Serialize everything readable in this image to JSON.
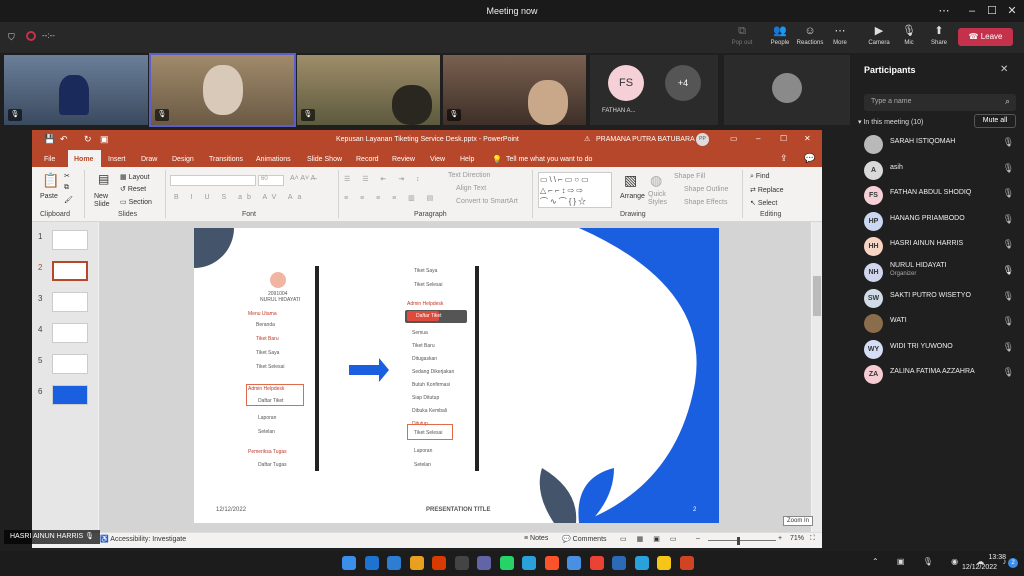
{
  "window": {
    "title": "Meeting now"
  },
  "teams_toolbar": {
    "timer": "--:--",
    "pop_out": "Pop out",
    "people": "People",
    "reactions": "Reactions",
    "more": "More",
    "camera": "Camera",
    "mic": "Mic",
    "share": "Share",
    "leave": "Leave"
  },
  "videos": {
    "fs_initials": "FS",
    "fs_name": "FATHAN A...",
    "overflow": "+4",
    "bottom_name": "HASRI AINUN HARRIS"
  },
  "participants": {
    "title": "Participants",
    "search_placeholder": "Type a name",
    "in_meeting": "In this meeting (10)",
    "mute_all": "Mute all",
    "list": [
      {
        "initials": "",
        "name": "SARAH ISTIQOMAH",
        "role": "",
        "color": "#b9b9b9"
      },
      {
        "initials": "A",
        "name": "asih",
        "role": "",
        "color": "#d9d9d9"
      },
      {
        "initials": "FS",
        "name": "FATHAN ABDUL SHODIQ",
        "role": "",
        "color": "#f6d0d7"
      },
      {
        "initials": "HP",
        "name": "HANANG PRIAMBODO",
        "role": "",
        "color": "#c9d7f3"
      },
      {
        "initials": "HH",
        "name": "HASRI AINUN HARRIS",
        "role": "",
        "color": "#f7d5c4"
      },
      {
        "initials": "NH",
        "name": "NURUL HIDAYATI",
        "role": "Organizer",
        "color": "#cfd6ee"
      },
      {
        "initials": "SW",
        "name": "SAKTI PUTRO WISETYO",
        "role": "",
        "color": "#d2dce6"
      },
      {
        "initials": "",
        "name": "WATI",
        "role": "",
        "color": "#8a6d4a"
      },
      {
        "initials": "WY",
        "name": "WIDI TRI YUWONO",
        "role": "",
        "color": "#d6def5"
      },
      {
        "initials": "ZA",
        "name": "ZALINA FATIMA AZZAHRA",
        "role": "",
        "color": "#f6ccd3"
      }
    ]
  },
  "ppt": {
    "title": "Kepusan Layanan Tiketing Service Desk.pptx  -  PowerPoint",
    "user": "PRAMANA PUTRA BATUBARA",
    "user_initials": "PP",
    "tabs": [
      "File",
      "Home",
      "Insert",
      "Draw",
      "Design",
      "Transitions",
      "Animations",
      "Slide Show",
      "Record",
      "Review",
      "View",
      "Help"
    ],
    "tell_me": "Tell me what you want to do",
    "groups": {
      "clipboard": "Clipboard",
      "slides": "Slides",
      "font": "Font",
      "paragraph": "Paragraph",
      "drawing": "Drawing",
      "editing": "Editing"
    },
    "buttons": {
      "paste": "Paste",
      "new_slide": "New Slide",
      "layout": "Layout",
      "reset": "Reset",
      "section": "Section",
      "text_direction": "Text Direction",
      "align_text": "Align Text",
      "convert_smartart": "Convert to SmartArt",
      "arrange": "Arrange",
      "quick_styles": "Quick Styles",
      "shape_fill": "Shape Fill",
      "shape_outline": "Shape Outline",
      "shape_effects": "Shape Effects",
      "find": "Find",
      "replace": "Replace",
      "select": "Select",
      "font_size": "60"
    },
    "slide_numbers": [
      "1",
      "2",
      "3",
      "4",
      "5",
      "6"
    ],
    "slide": {
      "date": "12/12/2022",
      "footer": "PRESENTATION TITLE",
      "page": "2",
      "left": {
        "id": "2091004",
        "user": "NURUL HIDAYATI",
        "menu_header": "Menu Utama",
        "items": [
          "Beranda",
          "Tiket Baru",
          "Tiket Saya",
          "Tiket Selesai"
        ],
        "admin_header": "Admin Helpdesk",
        "admin_item": "Daftar Tiket",
        "laporan": "Laporan",
        "setelan": "Setelan",
        "pemeriksa_header": "Pemeriksa Tugas",
        "daftar_tugas": "Daftar Tugas"
      },
      "right": {
        "items_top": [
          "Tiket Saya",
          "Tiket Selesai"
        ],
        "admin_header": "Admin Helpdesk",
        "daftar": "Daftar Tiket",
        "sub": [
          "Semua",
          "Tiket Baru",
          "Ditugaskan",
          "Sedang Dikerjakan",
          "Butuh Konfirmasi",
          "Siap Ditutup",
          "Dibuka Kembali"
        ],
        "ditutup": "Ditutup",
        "selesai": "Tiket Selesai",
        "laporan": "Laporan",
        "setelan": "Setelan"
      }
    },
    "status": {
      "accessibility": "Accessibility: Investigate",
      "notes": "Notes",
      "comments": "Comments",
      "zoom": "71%",
      "zoom_tooltip": "Zoom In"
    }
  },
  "taskbar": {
    "time": "13:38",
    "date": "12/12/2022",
    "badge_telegram": "1",
    "badge_2": "2"
  },
  "colors": {
    "accent_ppt": "#b7472a",
    "leave_red": "#c4314b",
    "slide_blue": "#1a5fe0",
    "navy": "#44546a"
  }
}
